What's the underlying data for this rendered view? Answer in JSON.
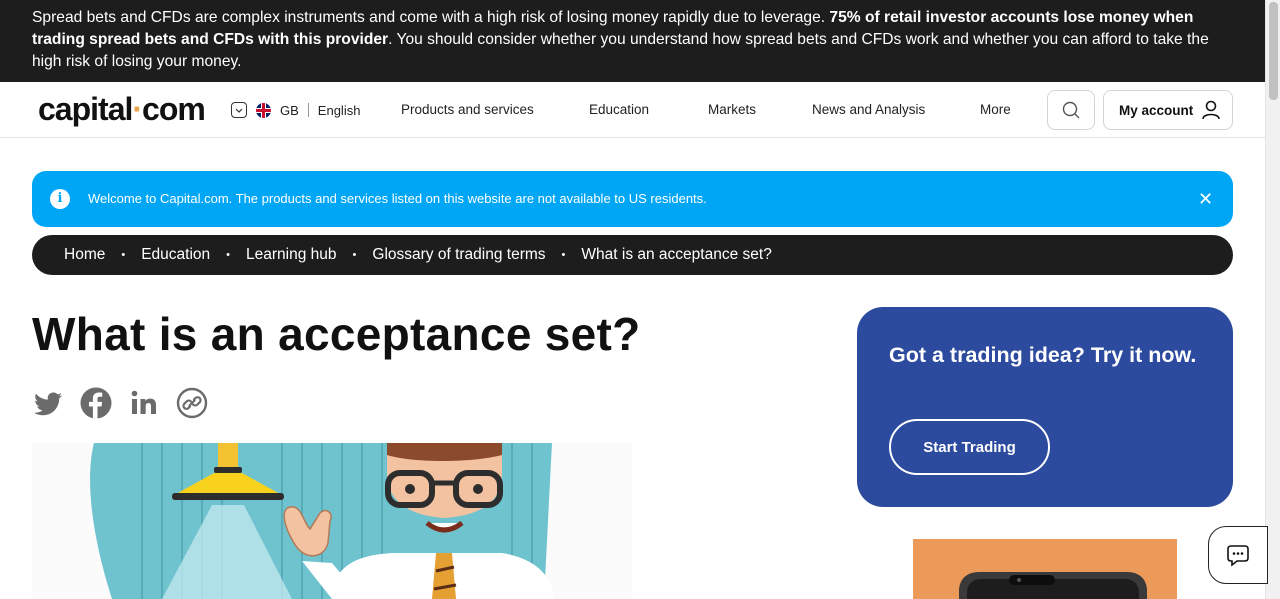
{
  "risk_banner": {
    "text_1": "Spread bets and CFDs are complex instruments and come with a high risk of losing money rapidly due to leverage. ",
    "bold": "75% of retail investor accounts lose money when trading spread bets and CFDs with this provider",
    "text_2": ". You should consider whether you understand how spread bets and CFDs work and whether you can afford to take the high risk of losing your money."
  },
  "header": {
    "logo": {
      "left": "capital",
      "dot": "·",
      "right": "com"
    },
    "locale": {
      "country": "GB",
      "language": "English"
    },
    "nav": [
      "Products and services",
      "Education",
      "Markets",
      "News and Analysis",
      "More"
    ],
    "account_label": "My account"
  },
  "notice": {
    "icon": "info-icon",
    "text": "Welcome to Capital.com. The products and services listed on this website are not available to US residents.",
    "close": "✕"
  },
  "breadcrumb": [
    "Home",
    "Education",
    "Learning hub",
    "Glossary of trading terms",
    "What is an acceptance set?"
  ],
  "breadcrumb_separator": "•",
  "article": {
    "title": "What is an acceptance set?",
    "share_icons": [
      "twitter-icon",
      "facebook-icon",
      "linkedin-icon",
      "copy-link-icon"
    ]
  },
  "cta": {
    "title": "Got a trading idea? Try it now.",
    "button": "Start Trading"
  },
  "colors": {
    "banner_bg": "#1d1d1d",
    "notice_bg": "#00a6f6",
    "cta_bg": "#2c4a9e",
    "logo_dot": "#e9a24c",
    "icon_grey": "#6b6b6b"
  }
}
